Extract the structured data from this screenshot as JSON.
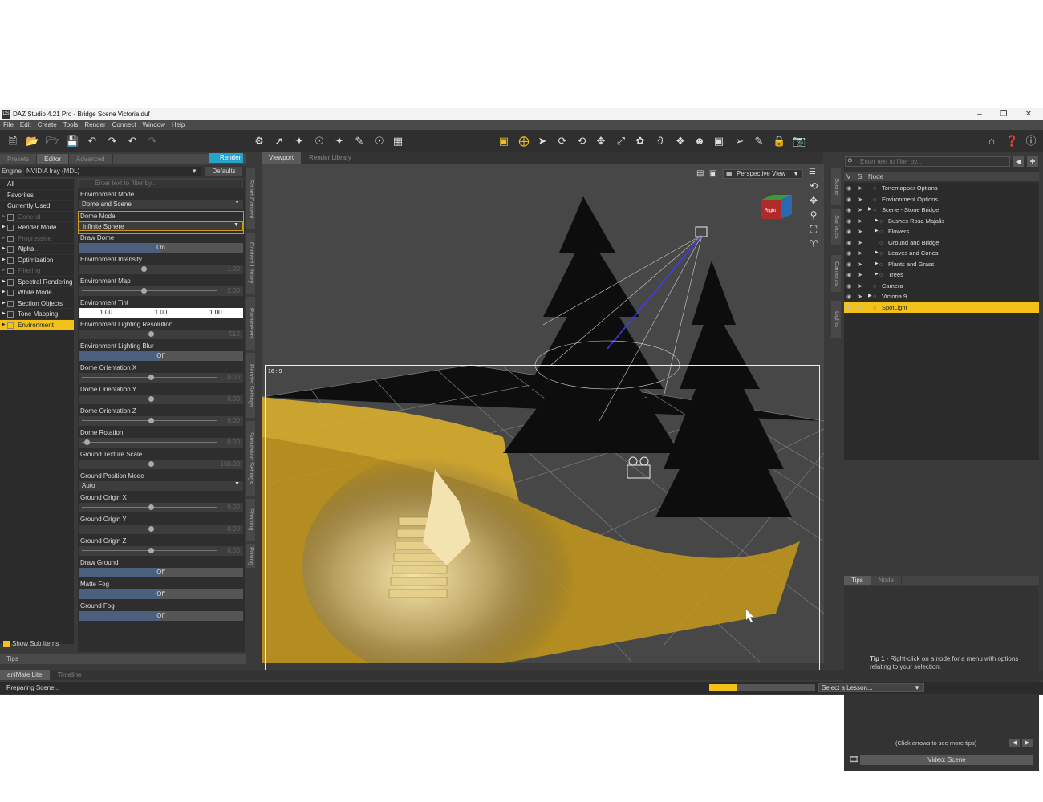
{
  "window": {
    "title": "DAZ Studio 4.21 Pro - Bridge Scene Victoria.duf",
    "app_icon": "DS"
  },
  "menu": [
    "File",
    "Edit",
    "Create",
    "Tools",
    "Render",
    "Connect",
    "Window",
    "Help"
  ],
  "left_panel": {
    "tabs": [
      "Presets",
      "Editor",
      "Advanced"
    ],
    "render_button": "Render",
    "engine_label": "Engine",
    "engine_value": "NVIDIA Iray (MDL)",
    "defaults_button": "Defaults",
    "filter_placeholder": "Enter text to filter by...",
    "categories": [
      {
        "label": "All",
        "type": "top"
      },
      {
        "label": "Favorites",
        "type": "top"
      },
      {
        "label": "Currently Used",
        "type": "top"
      },
      {
        "label": "General",
        "type": "sub",
        "disabled": true
      },
      {
        "label": "Render Mode",
        "type": "sub"
      },
      {
        "label": "Progressive Rend...",
        "type": "sub",
        "disabled": true
      },
      {
        "label": "Alpha",
        "type": "sub"
      },
      {
        "label": "Optimization",
        "type": "sub"
      },
      {
        "label": "Filtering",
        "type": "sub",
        "disabled": true
      },
      {
        "label": "Spectral Rendering",
        "type": "sub"
      },
      {
        "label": "White Mode",
        "type": "sub"
      },
      {
        "label": "Section Objects",
        "type": "sub"
      },
      {
        "label": "Tone Mapping",
        "type": "sub"
      },
      {
        "label": "Environment",
        "type": "sub",
        "selected": true
      }
    ],
    "properties": [
      {
        "label": "Environment Mode",
        "kind": "dropdown",
        "value": "Dome and Scene"
      },
      {
        "label": "Dome Mode",
        "kind": "dropdown",
        "value": "Infinite Sphere",
        "highlight": true
      },
      {
        "label": "Draw Dome",
        "kind": "toggle",
        "value": "On"
      },
      {
        "label": "Environment Intensity",
        "kind": "slider",
        "value": "1.00",
        "pos": 0.45
      },
      {
        "label": "Environment Map",
        "kind": "slider",
        "value": "2.00",
        "pos": 0.45
      },
      {
        "label": "Environment Tint",
        "kind": "tint",
        "value": [
          "1.00",
          "1.00",
          "1.00"
        ]
      },
      {
        "label": "Environment Lighting Resolution",
        "kind": "slider",
        "value": "512",
        "pos": 0.5
      },
      {
        "label": "Environment Lighting Blur",
        "kind": "toggle",
        "value": "Off"
      },
      {
        "label": "Dome Orientation X",
        "kind": "slider",
        "value": "0.00",
        "pos": 0.5
      },
      {
        "label": "Dome Orientation Y",
        "kind": "slider",
        "value": "0.00",
        "pos": 0.5
      },
      {
        "label": "Dome Orientation Z",
        "kind": "slider",
        "value": "0.00",
        "pos": 0.5
      },
      {
        "label": "Dome Rotation",
        "kind": "slider",
        "value": "0.00",
        "pos": 0.02
      },
      {
        "label": "Ground Texture Scale",
        "kind": "slider",
        "value": "100.00",
        "pos": 0.5
      },
      {
        "label": "Ground Position Mode",
        "kind": "dropdown",
        "value": "Auto"
      },
      {
        "label": "Ground Origin X",
        "kind": "slider",
        "value": "0.00",
        "pos": 0.5
      },
      {
        "label": "Ground Origin Y",
        "kind": "slider",
        "value": "0.00",
        "pos": 0.5
      },
      {
        "label": "Ground Origin Z",
        "kind": "slider",
        "value": "0.00",
        "pos": 0.5
      },
      {
        "label": "Draw Ground",
        "kind": "toggle",
        "value": "Off"
      },
      {
        "label": "Matte Fog",
        "kind": "toggle",
        "value": "Off"
      },
      {
        "label": "Ground Fog",
        "kind": "toggle",
        "value": "Off"
      }
    ],
    "show_sub_items": "Show Sub Items",
    "tips_tab": "Tips",
    "side_tabs": [
      "Smart Content",
      "Content Library",
      "Parameters",
      "Render Settings",
      "Simulation Settings",
      "Shaping",
      "Posing"
    ]
  },
  "viewport": {
    "tabs": [
      "Viewport",
      "Render Library"
    ],
    "view_mode": "Perspective View",
    "aspect": "16 : 9",
    "cube_label": "Right"
  },
  "right_panel": {
    "side_tabs": [
      "Scene",
      "Surfaces",
      "Cameras",
      "Lights"
    ],
    "filter_placeholder": "Enter text to filter by...",
    "header": {
      "v": "V",
      "s": "S",
      "node": "Node"
    },
    "nodes": [
      {
        "label": "Tonemapper Options",
        "indent": 0,
        "arrow": false
      },
      {
        "label": "Environment Options",
        "indent": 0,
        "arrow": false
      },
      {
        "label": "Scene - Stone Bridge",
        "indent": 0,
        "arrow": true
      },
      {
        "label": "Bushes Rosa Majalis",
        "indent": 1,
        "arrow": true
      },
      {
        "label": "Flowers",
        "indent": 1,
        "arrow": true
      },
      {
        "label": "Ground and Bridge",
        "indent": 1,
        "arrow": false
      },
      {
        "label": "Leaves and Cones",
        "indent": 1,
        "arrow": true
      },
      {
        "label": "Plants and Grass",
        "indent": 1,
        "arrow": true
      },
      {
        "label": "Trees",
        "indent": 1,
        "arrow": true
      },
      {
        "label": "Camera",
        "indent": 0,
        "arrow": false
      },
      {
        "label": "Victoria 9",
        "indent": 0,
        "arrow": true
      },
      {
        "label": "SpotLight",
        "indent": 0,
        "arrow": false,
        "selected": true
      }
    ],
    "bottom_tabs": [
      "Tips",
      "Node"
    ],
    "tip_title": "Tip 1",
    "tip_body": " - Right-click on a node for a menu with options relating to your selection.",
    "tip_arrows": "(Click arrows to see more tips)",
    "video_button": "Video: Scene"
  },
  "bottom": {
    "tabs": [
      "aniMate Lite",
      "Timeline"
    ],
    "status": "Preparing Scene...",
    "progress": 0.26,
    "lesson_placeholder": "Select a Lesson..."
  },
  "colors": {
    "accent": "#f3c21a",
    "render": "#27a3c9",
    "panel": "#3a3a3a"
  }
}
